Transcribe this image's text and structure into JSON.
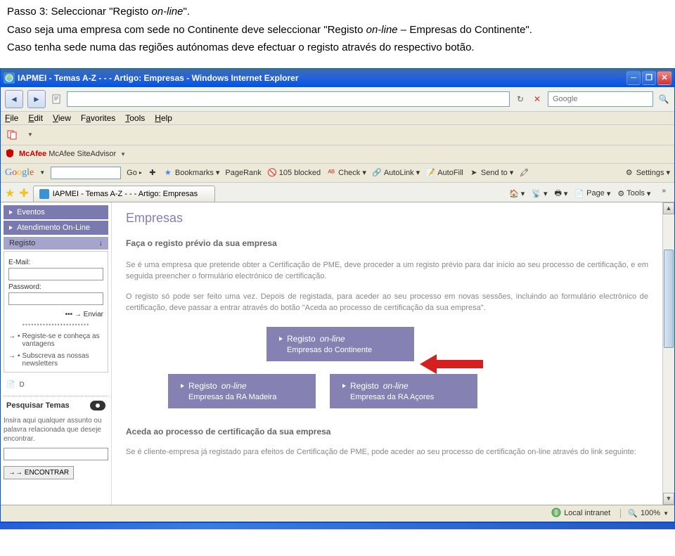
{
  "doc": {
    "step_prefix": "Passo 3: Seleccionar ",
    "step_quote": "\"Registo ",
    "step_italic": "on-line",
    "step_suffix": "\".",
    "line2a": "Caso seja uma empresa com sede no Continente deve seleccionar \"Registo ",
    "line2b": "on-line",
    "line2c": " – Empresas do Continente\".",
    "line3": "Caso tenha sede numa das regiões autónomas deve efectuar o registo através do respectivo botão."
  },
  "window": {
    "title": "IAPMEI - Temas A-Z - - - Artigo: Empresas - Windows Internet Explorer",
    "search_placeholder": "Google"
  },
  "menu": {
    "file": "File",
    "edit": "Edit",
    "view": "View",
    "favorites": "Favorites",
    "tools": "Tools",
    "help": "Help"
  },
  "mcafee": "McAfee SiteAdvisor",
  "google": {
    "go": "Go",
    "bookmarks": "Bookmarks",
    "pagerank": "PageRank",
    "blocked": "105 blocked",
    "check": "Check",
    "autolink": "AutoLink",
    "autofill": "AutoFill",
    "sendto": "Send to",
    "settings": "Settings"
  },
  "tab": {
    "label": "IAPMEI - Temas A-Z - - - Artigo: Empresas"
  },
  "tabright": {
    "home": "",
    "print": "",
    "page": "Page",
    "tools": "Tools"
  },
  "sidebar": {
    "eventos": "Eventos",
    "atendimento": "Atendimento On-Line",
    "registo": "Registo",
    "email": "E-Mail:",
    "password": "Password:",
    "enviar": "••• →  Enviar",
    "link1": "Registe-se e conheça as vantagens",
    "link2": "Subscreva as nossas newsletters",
    "d": "D",
    "pesq_title": "Pesquisar Temas",
    "pesq_text": "Insira aqui qualquer assunto ou palavra relacionada que deseje encontrar.",
    "encontrar": "→→ ENCONTRAR"
  },
  "main": {
    "title": "Empresas",
    "sub": "Faça o registo prévio da sua empresa",
    "p1": "Se é uma empresa que pretende obter a Certificação de PME, deve proceder a um registo prévio para dar início ao seu processo de certificação, e em seguida preencher o formulário electrónico de certificação.",
    "p2": "O registo só pode ser feito uma vez. Depois de registada, para aceder ao seu processo em novas sessões, incluindo ao formulário electrónico de certificação, deve passar a entrar através do botão \"Aceda ao processo de certificação da sua empresa\".",
    "btn1_l1": "Registo ",
    "btn1_it": "on-line",
    "btn1_l2": "Empresas do Continente",
    "btn2_l1": "Registo ",
    "btn2_it": "on-line",
    "btn2_l2": "Empresas da RA Madeira",
    "btn3_l1": "Registo ",
    "btn3_it": "on-line",
    "btn3_l2": "Empresas da RA Açores",
    "sub2": "Aceda ao processo de certificação da sua empresa",
    "p3": "Se é cliente-empresa já registado para efeitos de Certificação de PME, pode aceder ao seu processo de certificação on-line através do link seguinte:"
  },
  "status": {
    "local": "Local intranet",
    "zoom": "100%"
  }
}
